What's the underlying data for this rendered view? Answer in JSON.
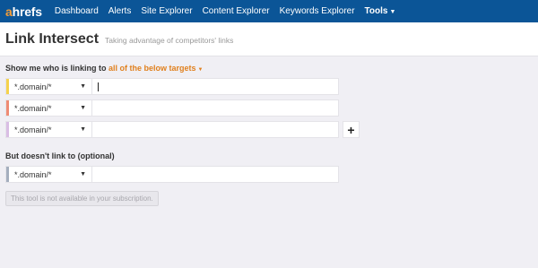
{
  "nav": {
    "logo_a": "a",
    "logo_rest": "hrefs",
    "items": [
      "Dashboard",
      "Alerts",
      "Site Explorer",
      "Content Explorer",
      "Keywords Explorer"
    ],
    "tools_label": "Tools",
    "tools_caret": "▼"
  },
  "header": {
    "title": "Link Intersect",
    "subtitle": "Taking advantage of competitors' links"
  },
  "targets": {
    "label_prefix": "Show me who is linking to",
    "label_highlight": "all of the below targets",
    "label_caret": "▼",
    "rows": [
      {
        "mode": "*.domain/*",
        "value": "",
        "color": "#f5d24c"
      },
      {
        "mode": "*.domain/*",
        "value": "",
        "color": "#ef8b74"
      },
      {
        "mode": "*.domain/*",
        "value": "",
        "color": "#d9bde4"
      }
    ],
    "add_label": "+"
  },
  "exclude": {
    "label": "But doesn't link to (optional)",
    "row": {
      "mode": "*.domain/*",
      "value": "",
      "color": "#a4aebe"
    }
  },
  "notice": "This tool is not available in your subscription.",
  "select_caret": "▼"
}
